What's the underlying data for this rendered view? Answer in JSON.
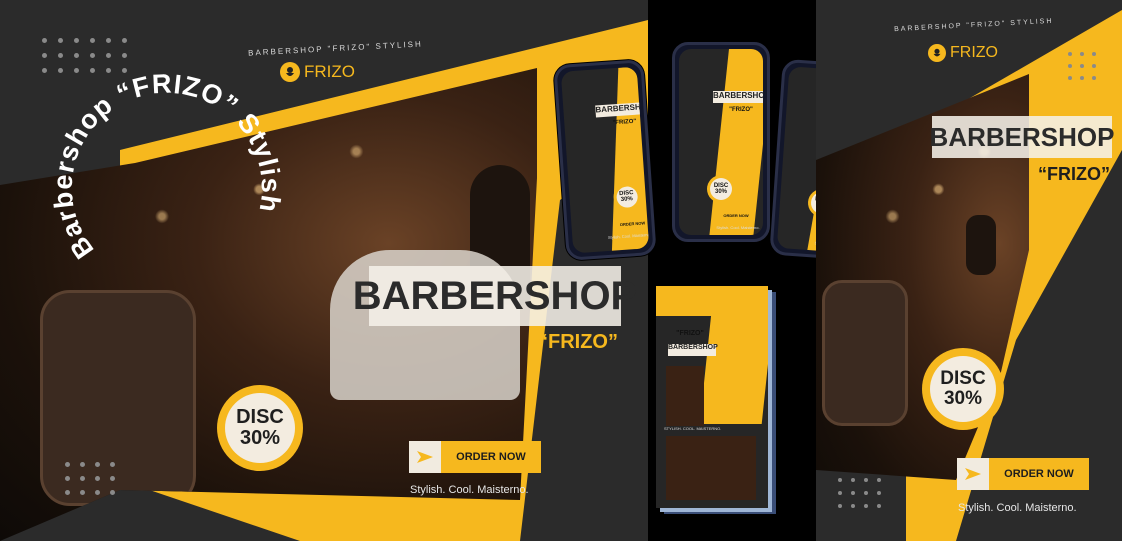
{
  "brand": {
    "logo_text": "FRIZO",
    "caption": "BARBERSHOP \"FRIZO\" STYLISH",
    "curved_text": "Barbershop “FRIZO” Stylish"
  },
  "promo": {
    "title": "BARBERSHOP",
    "quote": "“FRIZO”",
    "disc_line1": "DISC",
    "disc_line2": "30%",
    "order_label": "ORDER NOW",
    "tagline": "Stylish. Cool. Maisterno."
  },
  "mockups": {
    "phone_title": "BARBERSHOP",
    "phone_quote": "\"FRIZO\"",
    "phone_disc1": "DISC",
    "phone_disc2": "30%",
    "phone_order": "ORDER NOW",
    "phone_tag": "Stylish. Cool. Maisterno.",
    "book_quote": "\"FRIZO\"",
    "book_title": "BARBERSHOP",
    "book_tag": "STYLISH. COOL. MAISTERNO."
  },
  "colors": {
    "accent": "#f6b81e",
    "dark": "#2b2b2b",
    "cream": "#f3ece0"
  },
  "icons": [
    "play-arrow-icon",
    "bearded-man-icon"
  ]
}
